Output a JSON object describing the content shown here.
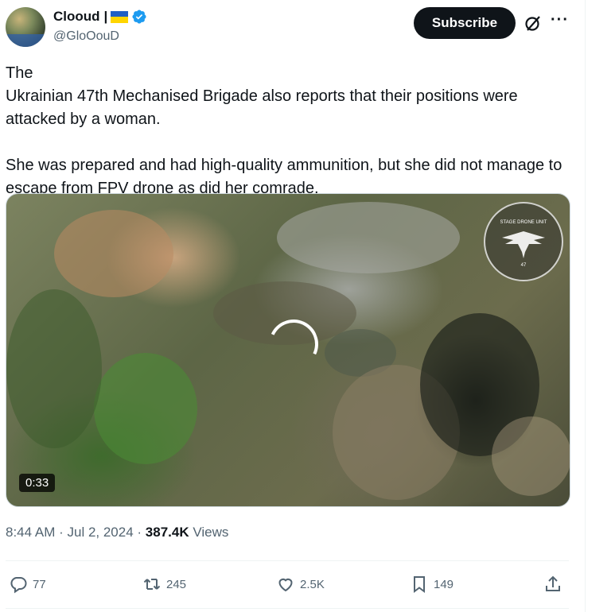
{
  "author": {
    "display_name": "Clooud",
    "handle": "@GloOouD",
    "name_suffix": "|"
  },
  "header": {
    "subscribe_label": "Subscribe"
  },
  "tweet": {
    "paragraph_1_before_flag": "The ",
    "paragraph_1_after_flag": "Ukrainian 47th Mechanised Brigade also reports that their positions were attacked by a woman.",
    "paragraph_2": "She was prepared and had high-quality ammunition, but she did not manage to escape from FPV drone as did her comrade."
  },
  "media": {
    "duration": "0:33",
    "watermark_top": "STAGE DRONE UNIT",
    "watermark_bottom": "47"
  },
  "meta": {
    "time": "8:44 AM",
    "sep1": " · ",
    "date": "Jul 2, 2024",
    "sep2": " · ",
    "views_count": "387.4K",
    "views_label": " Views"
  },
  "actions": {
    "replies": "77",
    "reposts": "245",
    "likes": "2.5K",
    "bookmarks": "149"
  },
  "colors": {
    "primary_text": "#0f1419",
    "secondary_text": "#536471",
    "verified_blue": "#1d9bf0",
    "flag_blue": "#1f5fc5",
    "flag_yellow": "#ffd500"
  },
  "icons": [
    "verified-badge-icon",
    "grok-icon",
    "more-icon",
    "reply-icon",
    "repost-icon",
    "like-icon",
    "bookmark-icon",
    "share-icon"
  ]
}
